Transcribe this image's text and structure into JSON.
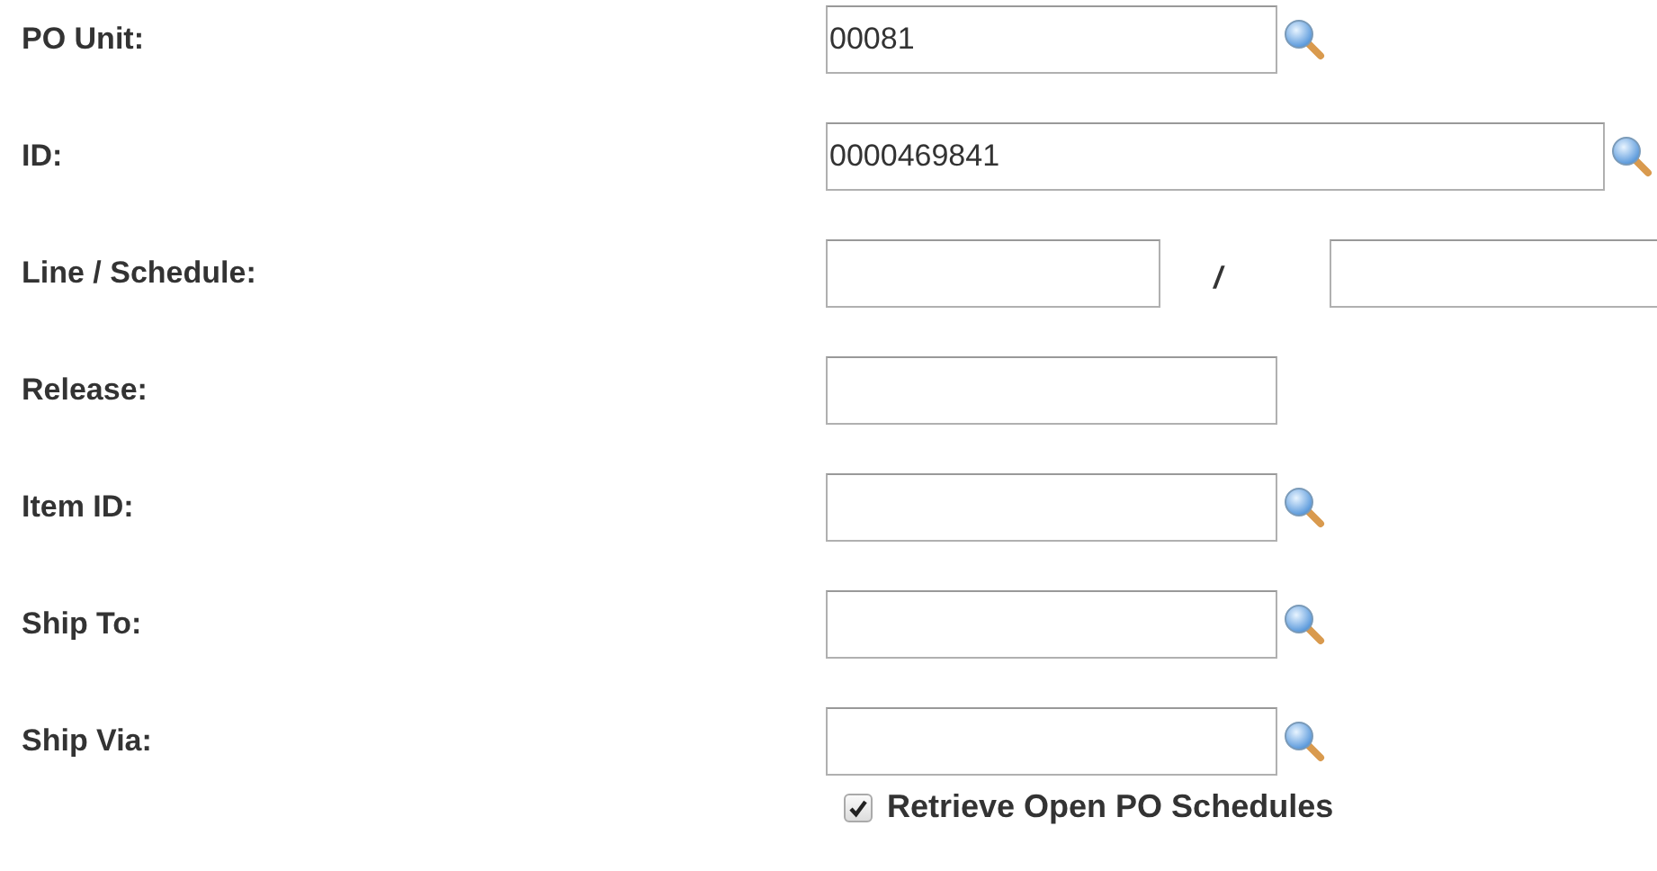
{
  "fields": [
    {
      "label": "PO Unit:",
      "kind": "lookup",
      "value": "00081",
      "wide": false
    },
    {
      "label": "ID:",
      "kind": "lookup",
      "value": "0000469841",
      "wide": true
    },
    {
      "label": "Line / Schedule:",
      "kind": "pair",
      "separator": "/"
    },
    {
      "label": "Release:",
      "kind": "text"
    },
    {
      "label": "Item ID:",
      "kind": "lookup",
      "wide": false
    },
    {
      "label": "Ship To:",
      "kind": "lookup",
      "wide": false
    },
    {
      "label": "Ship Via:",
      "kind": "lookup",
      "wide": false
    }
  ],
  "option": {
    "label": "Retrieve Open PO Schedules",
    "checked": true
  }
}
